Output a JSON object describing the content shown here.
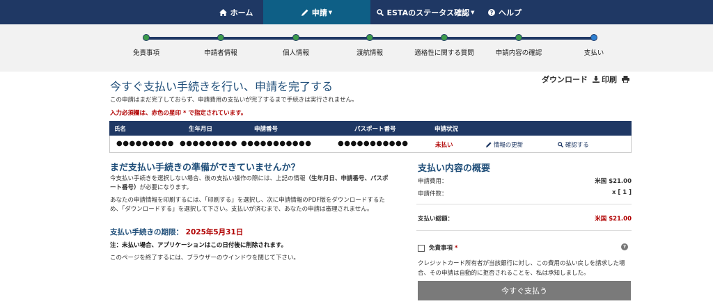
{
  "nav": {
    "home": "ホーム",
    "apply": "申請",
    "status": "ESTAのステータス確認",
    "help": "ヘルプ"
  },
  "steps": [
    "免責事項",
    "申請者情報",
    "個人情報",
    "渡航情報",
    "適格性に関する質問",
    "申請内容の確認",
    "支払い"
  ],
  "header": {
    "title": "今すぐ支払い手続きを行い、申請を完了する",
    "download": "ダウンロード",
    "print": "印刷",
    "intro": "この申請はまだ完了しておらず、申請費用の支払いが完了するまで手続きは実行されません。",
    "required_note": "入力必須欄は、赤色の星印 * で指定されています。"
  },
  "table": {
    "headers": [
      "氏名",
      "生年月日",
      "申請番号",
      "パスポート番号",
      "申請状況"
    ],
    "row": {
      "name": "●●●●●●●●●",
      "dob": "●●●●●●●●●",
      "app_no": "●●●●●●●●●●●",
      "passport": "●●●●●●●●●●●",
      "status": "未払い",
      "update": "情報の更新",
      "check": "確認する"
    }
  },
  "left": {
    "heading": "まだ支払い手続きの準備ができていませんか？",
    "para1a": "今支払い手続きを選択しない場合、後の支払い操作の際には、上記の情報",
    "para1b": "（生年月日、申請番号、パスポート番号）",
    "para1c": "が必要になります。",
    "para2": "あなたの申請情報を印刷するには、「印刷する」を選択し、次に申請情報のPDF版をダウンロードするため、「ダウンロードする」を選択して下さい。支払いが済むまで、あなたの申請は審理されません。",
    "deadline_label": "支払い手続きの期限：",
    "deadline_date": "2025年5月31日",
    "note": "注：未払い場合、アプリケーションはこの日付後に削除されます。",
    "close": "このページを終了するには、ブラウザーのウインドウを閉じて下さい。"
  },
  "summary": {
    "heading": "支払い内容の概要",
    "fee_label": "申請費用：",
    "fee_value": "米国 $21.00",
    "count_label": "申請件数：",
    "count_value": "x [ 1 ]",
    "total_label": "支払い総額：",
    "total_value": "米国 $21.00",
    "waiver_label": "免責事項",
    "waiver_star": "*",
    "disclaimer": "クレジットカード所有者が当該銀行に対し、この費用の払い戻しを請求した場合、その申請は自動的に拒否されることを、私は承知しました。",
    "pay_button": "今すぐ支払う"
  },
  "colors": {
    "navy": "#1f3864",
    "active_tab": "#0e5f86",
    "step_done": "#3d9b4b",
    "red": "#b00000",
    "button_gray": "#7a7a7a"
  }
}
